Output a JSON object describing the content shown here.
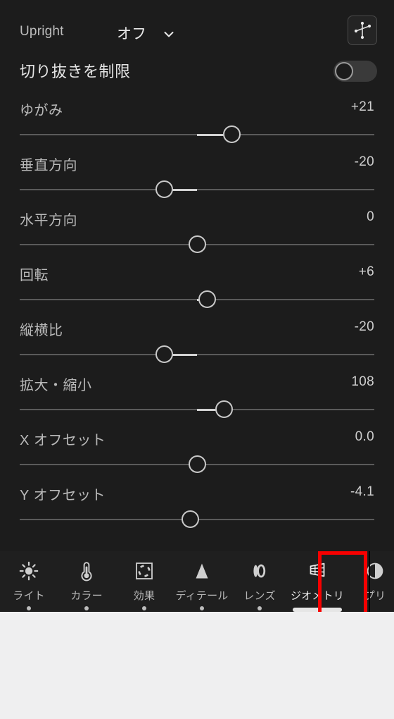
{
  "header": {
    "upright_label": "Upright",
    "upright_value": "オフ",
    "chevron_icon": "chevron-down-icon",
    "guided_upright_icon": "guided-upright-icon",
    "constrain_label": "切り抜きを制限",
    "constrain_toggle_state": "off"
  },
  "sliders": [
    {
      "label": "ゆがみ",
      "value": "+21",
      "thumb_pct": 59.9,
      "fill_from_pct": 50.0,
      "fill_to_pct": 59.9
    },
    {
      "label": "垂直方向",
      "value": "-20",
      "thumb_pct": 40.7,
      "fill_from_pct": 40.7,
      "fill_to_pct": 50.0
    },
    {
      "label": "水平方向",
      "value": "0",
      "thumb_pct": 50.0,
      "fill_from_pct": 50.0,
      "fill_to_pct": 50.0
    },
    {
      "label": "回転",
      "value": "+6",
      "thumb_pct": 52.8,
      "fill_from_pct": 50.0,
      "fill_to_pct": 52.8
    },
    {
      "label": "縦横比",
      "value": "-20",
      "thumb_pct": 40.7,
      "fill_from_pct": 40.7,
      "fill_to_pct": 50.0
    },
    {
      "label": "拡大・縮小",
      "value": "108",
      "thumb_pct": 57.7,
      "fill_from_pct": 50.0,
      "fill_to_pct": 57.7
    },
    {
      "label": "X オフセット",
      "value": "0.0",
      "thumb_pct": 50.0,
      "fill_from_pct": 50.0,
      "fill_to_pct": 50.0
    },
    {
      "label": "Y オフセット",
      "value": "-4.1",
      "thumb_pct": 48.2,
      "fill_from_pct": 48.2,
      "fill_to_pct": 50.0
    }
  ],
  "toolbar": {
    "tabs": [
      {
        "label": "ライト",
        "icon": "sun-icon",
        "active": false,
        "dot": true
      },
      {
        "label": "カラー",
        "icon": "thermometer-icon",
        "active": false,
        "dot": true
      },
      {
        "label": "効果",
        "icon": "effects-frame-icon",
        "active": false,
        "dot": true
      },
      {
        "label": "ディテール",
        "icon": "triangle-icon",
        "active": false,
        "dot": true
      },
      {
        "label": "レンズ",
        "icon": "lens-icon",
        "active": false,
        "dot": true
      },
      {
        "label": "ジオメトリ",
        "icon": "geometry-grid-icon",
        "active": true,
        "dot": false
      },
      {
        "label": "プリ",
        "icon": "presets-icon",
        "active": false,
        "dot": false
      }
    ]
  },
  "highlight": {
    "target": "ジオメトリ",
    "color": "#f80000"
  },
  "colors": {
    "panel_bg": "#1c1c1c",
    "toolbar_bg": "#1f1f1f",
    "page_bg": "#efeff0",
    "track": "#5a5a5a",
    "fill": "#d2d2d2",
    "thumb_ring": "#c9c9c9",
    "label_text": "#b9b9b9",
    "value_text": "#cecece"
  }
}
